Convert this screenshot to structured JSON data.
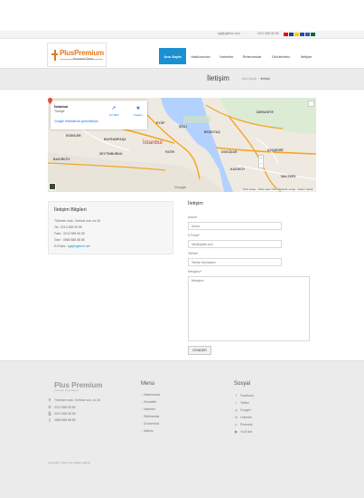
{
  "topbar": {
    "email": "sgt@gsthre.com",
    "phone": "0212 555 55 55",
    "flags": [
      {
        "name": "tr-flag",
        "color": "#e30a17"
      },
      {
        "name": "gb-flag",
        "color": "#1f3f8f"
      },
      {
        "name": "de-flag",
        "color": "#ffcc00"
      },
      {
        "name": "fr-flag",
        "color": "#1f4fa8"
      },
      {
        "name": "ru-flag",
        "color": "#2d5fb8"
      },
      {
        "name": "sa-flag",
        "color": "#006c35"
      }
    ]
  },
  "logo": {
    "title": "PlusPremium",
    "subtitle": "Kurumsal Tema"
  },
  "nav": {
    "items": [
      {
        "label": "Ana Sayfa",
        "active": true
      },
      {
        "label": "Hakkımızda",
        "active": false
      },
      {
        "label": "Haberler",
        "active": false
      },
      {
        "label": "Referanslar",
        "active": false
      },
      {
        "label": "Ürünlerimiz",
        "active": false
      },
      {
        "label": "İletişim",
        "active": false
      }
    ]
  },
  "page": {
    "title": "İletişim",
    "breadcrumb": [
      "Ana Sayfa",
      "/",
      "İletişim"
    ]
  },
  "map": {
    "card": {
      "place": "İstanbul",
      "country": "Türkiye",
      "larger_map": "Google Haritalar'da görüntüleyin",
      "directions": "Yol Tarifi",
      "save": "Kaydet"
    },
    "labels": [
      {
        "text": "ÜMRANİYE"
      },
      {
        "text": "BEŞİKTAŞ"
      },
      {
        "text": "ŞİŞLİ"
      },
      {
        "text": "İstanbul"
      },
      {
        "text": "ÜSKÜDAR"
      },
      {
        "text": "KADIKÖY"
      },
      {
        "text": "ATAŞEHİR"
      },
      {
        "text": "ZEYTİNBURNU"
      },
      {
        "text": "BAKIRKÖY"
      },
      {
        "text": "ESENLER"
      },
      {
        "text": "BAYRAMPAŞA"
      },
      {
        "text": "EYÜP"
      },
      {
        "text": "FATİH"
      },
      {
        "text": "MALTEPE"
      }
    ],
    "google": "Google",
    "footer_text": "©2014 Google · Harita verileri ©2014 Basarsoft, Google · Kullanım Şartları",
    "zoom_in": "+",
    "zoom_out": "−",
    "colors": {
      "water": "#b3d1ff",
      "land": "#eeeae2",
      "road": "#f5a623"
    }
  },
  "info": {
    "title": "İletişim Bilgileri",
    "address": "Türkmen mah. Cerkezi sok. no:16",
    "phone": "Tel : 0212 555 55 55",
    "fax": "Faks : 0212 555 55 55",
    "gsm": "Gsm : 0566 888 88 88",
    "email_label": "E-Posta :",
    "email": "sgt@sgttech.net"
  },
  "form": {
    "title": "İletişim",
    "name_label": "Adınız",
    "name_placeholder": "Adınız",
    "email_label": "E-Posta",
    "email_placeholder": "info@apsite.com",
    "phone_label": "Telefon",
    "phone_placeholder": "Telefon Numaranız",
    "message_label": "Mesajınız",
    "message_placeholder": "Mesajınız",
    "submit": "GÖNDER"
  },
  "footer": {
    "brand": "Plus Premium",
    "brand_sub": "Kurumsal Tema Sistemi",
    "contact": {
      "address": "Türkmen mah. Cerkezi sok. no:16",
      "phone": "0212 555 55 55",
      "fax": "0212 555 55 55",
      "gsm": "0566 888 88 88"
    },
    "menu_title": "Menu",
    "menu": [
      "Hakkımızda",
      "Hizmetler",
      "Haberler",
      "Referanslar",
      "Ürünlerimiz",
      "İletişim"
    ],
    "social_title": "Sosyal",
    "social": [
      {
        "label": "Facebook",
        "icon": "f"
      },
      {
        "label": "Twitter",
        "icon": "t"
      },
      {
        "label": "Google+",
        "icon": "g"
      },
      {
        "label": "LinkedIn",
        "icon": "in"
      },
      {
        "label": "Pinterest",
        "icon": "p"
      },
      {
        "label": "YouTube",
        "icon": "▶"
      }
    ],
    "copyright": "Copyright © 2014 Tüm hakları saklıdır."
  }
}
